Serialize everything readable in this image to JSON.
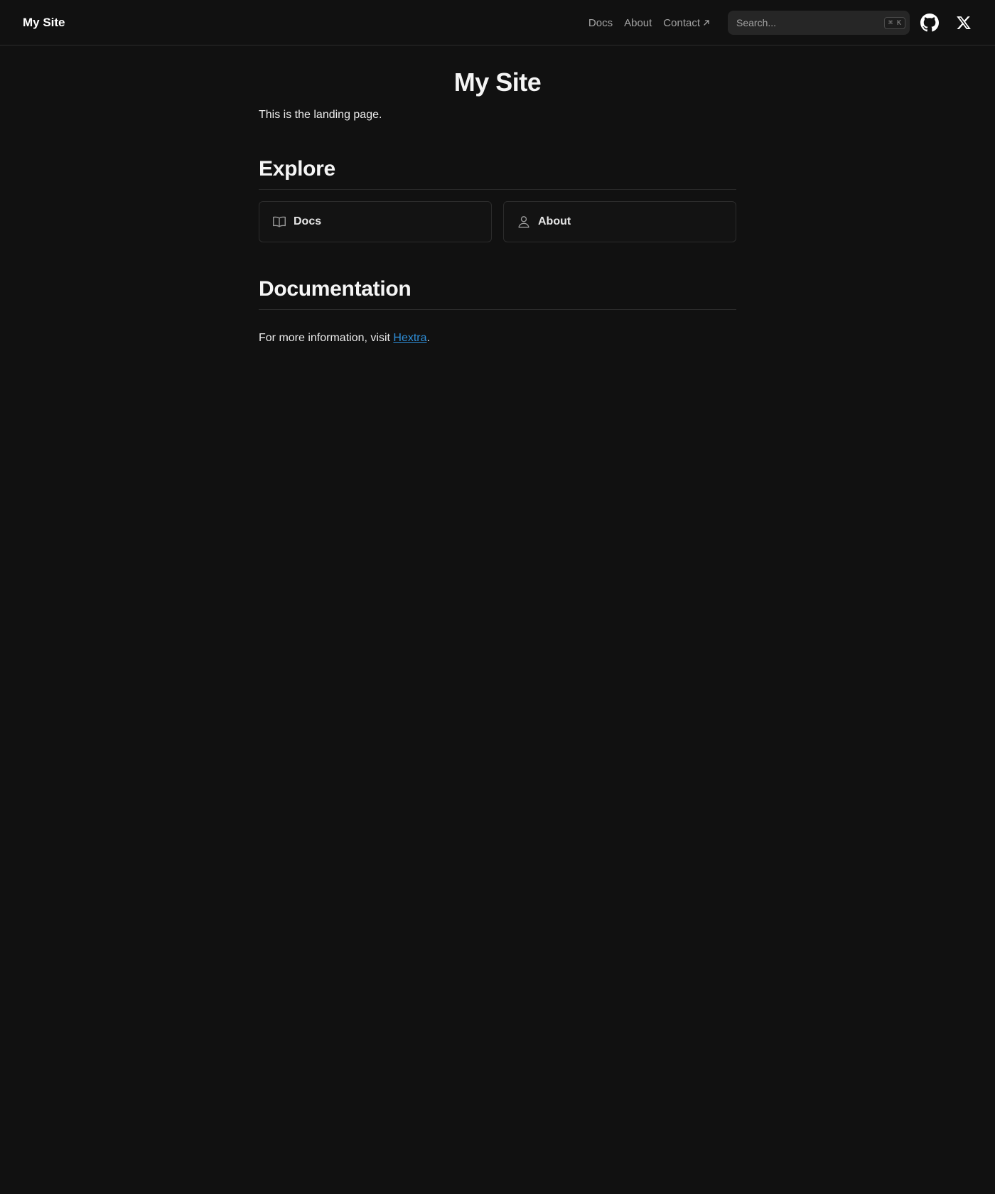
{
  "navbar": {
    "brand": "My Site",
    "links": [
      {
        "label": "Docs"
      },
      {
        "label": "About"
      },
      {
        "label": "Contact"
      }
    ],
    "search": {
      "placeholder": "Search...",
      "shortcut": "⌘ K"
    },
    "icons": [
      "github-icon",
      "x-icon"
    ]
  },
  "main": {
    "title": "My Site",
    "lead": "This is the landing page.",
    "explore": {
      "heading": "Explore",
      "cards": [
        {
          "label": "Docs",
          "icon": "book-open-icon"
        },
        {
          "label": "About",
          "icon": "user-icon"
        }
      ]
    },
    "documentation": {
      "heading": "Documentation",
      "text_before": "For more information, visit ",
      "link_label": "Hextra",
      "text_after": "."
    }
  },
  "colors": {
    "background": "#111111",
    "border": "#2c2c2c",
    "link": "#2e8ed8",
    "nav_text": "#a3a3a3"
  }
}
